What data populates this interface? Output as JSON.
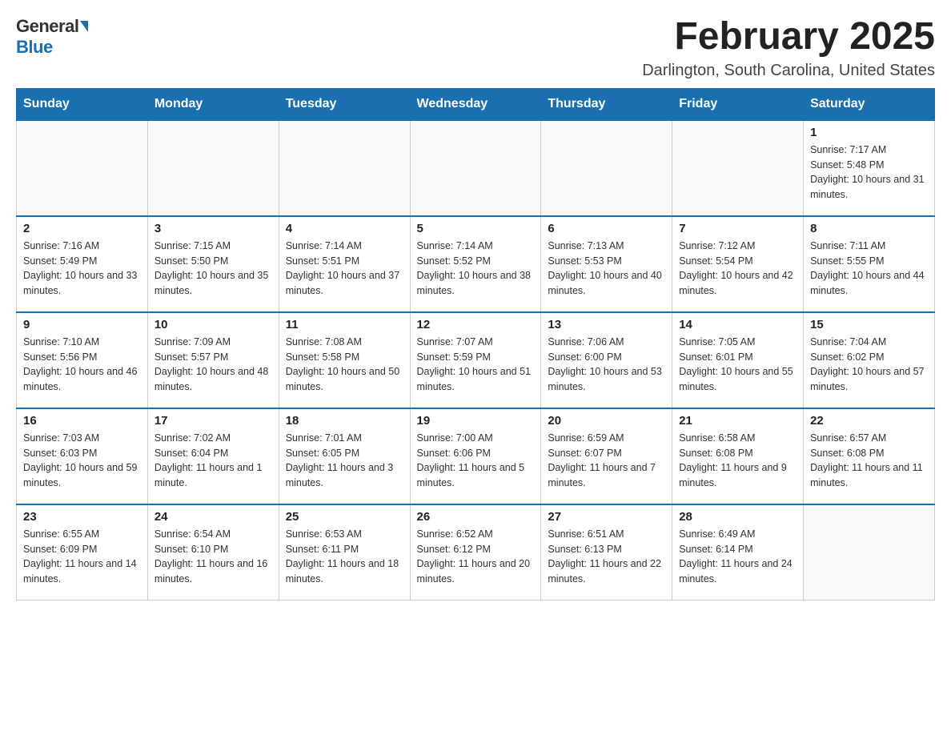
{
  "header": {
    "logo_general": "General",
    "logo_blue": "Blue",
    "title": "February 2025",
    "subtitle": "Darlington, South Carolina, United States"
  },
  "days_of_week": [
    "Sunday",
    "Monday",
    "Tuesday",
    "Wednesday",
    "Thursday",
    "Friday",
    "Saturday"
  ],
  "weeks": [
    [
      {
        "day": "",
        "info": ""
      },
      {
        "day": "",
        "info": ""
      },
      {
        "day": "",
        "info": ""
      },
      {
        "day": "",
        "info": ""
      },
      {
        "day": "",
        "info": ""
      },
      {
        "day": "",
        "info": ""
      },
      {
        "day": "1",
        "info": "Sunrise: 7:17 AM\nSunset: 5:48 PM\nDaylight: 10 hours and 31 minutes."
      }
    ],
    [
      {
        "day": "2",
        "info": "Sunrise: 7:16 AM\nSunset: 5:49 PM\nDaylight: 10 hours and 33 minutes."
      },
      {
        "day": "3",
        "info": "Sunrise: 7:15 AM\nSunset: 5:50 PM\nDaylight: 10 hours and 35 minutes."
      },
      {
        "day": "4",
        "info": "Sunrise: 7:14 AM\nSunset: 5:51 PM\nDaylight: 10 hours and 37 minutes."
      },
      {
        "day": "5",
        "info": "Sunrise: 7:14 AM\nSunset: 5:52 PM\nDaylight: 10 hours and 38 minutes."
      },
      {
        "day": "6",
        "info": "Sunrise: 7:13 AM\nSunset: 5:53 PM\nDaylight: 10 hours and 40 minutes."
      },
      {
        "day": "7",
        "info": "Sunrise: 7:12 AM\nSunset: 5:54 PM\nDaylight: 10 hours and 42 minutes."
      },
      {
        "day": "8",
        "info": "Sunrise: 7:11 AM\nSunset: 5:55 PM\nDaylight: 10 hours and 44 minutes."
      }
    ],
    [
      {
        "day": "9",
        "info": "Sunrise: 7:10 AM\nSunset: 5:56 PM\nDaylight: 10 hours and 46 minutes."
      },
      {
        "day": "10",
        "info": "Sunrise: 7:09 AM\nSunset: 5:57 PM\nDaylight: 10 hours and 48 minutes."
      },
      {
        "day": "11",
        "info": "Sunrise: 7:08 AM\nSunset: 5:58 PM\nDaylight: 10 hours and 50 minutes."
      },
      {
        "day": "12",
        "info": "Sunrise: 7:07 AM\nSunset: 5:59 PM\nDaylight: 10 hours and 51 minutes."
      },
      {
        "day": "13",
        "info": "Sunrise: 7:06 AM\nSunset: 6:00 PM\nDaylight: 10 hours and 53 minutes."
      },
      {
        "day": "14",
        "info": "Sunrise: 7:05 AM\nSunset: 6:01 PM\nDaylight: 10 hours and 55 minutes."
      },
      {
        "day": "15",
        "info": "Sunrise: 7:04 AM\nSunset: 6:02 PM\nDaylight: 10 hours and 57 minutes."
      }
    ],
    [
      {
        "day": "16",
        "info": "Sunrise: 7:03 AM\nSunset: 6:03 PM\nDaylight: 10 hours and 59 minutes."
      },
      {
        "day": "17",
        "info": "Sunrise: 7:02 AM\nSunset: 6:04 PM\nDaylight: 11 hours and 1 minute."
      },
      {
        "day": "18",
        "info": "Sunrise: 7:01 AM\nSunset: 6:05 PM\nDaylight: 11 hours and 3 minutes."
      },
      {
        "day": "19",
        "info": "Sunrise: 7:00 AM\nSunset: 6:06 PM\nDaylight: 11 hours and 5 minutes."
      },
      {
        "day": "20",
        "info": "Sunrise: 6:59 AM\nSunset: 6:07 PM\nDaylight: 11 hours and 7 minutes."
      },
      {
        "day": "21",
        "info": "Sunrise: 6:58 AM\nSunset: 6:08 PM\nDaylight: 11 hours and 9 minutes."
      },
      {
        "day": "22",
        "info": "Sunrise: 6:57 AM\nSunset: 6:08 PM\nDaylight: 11 hours and 11 minutes."
      }
    ],
    [
      {
        "day": "23",
        "info": "Sunrise: 6:55 AM\nSunset: 6:09 PM\nDaylight: 11 hours and 14 minutes."
      },
      {
        "day": "24",
        "info": "Sunrise: 6:54 AM\nSunset: 6:10 PM\nDaylight: 11 hours and 16 minutes."
      },
      {
        "day": "25",
        "info": "Sunrise: 6:53 AM\nSunset: 6:11 PM\nDaylight: 11 hours and 18 minutes."
      },
      {
        "day": "26",
        "info": "Sunrise: 6:52 AM\nSunset: 6:12 PM\nDaylight: 11 hours and 20 minutes."
      },
      {
        "day": "27",
        "info": "Sunrise: 6:51 AM\nSunset: 6:13 PM\nDaylight: 11 hours and 22 minutes."
      },
      {
        "day": "28",
        "info": "Sunrise: 6:49 AM\nSunset: 6:14 PM\nDaylight: 11 hours and 24 minutes."
      },
      {
        "day": "",
        "info": ""
      }
    ]
  ]
}
